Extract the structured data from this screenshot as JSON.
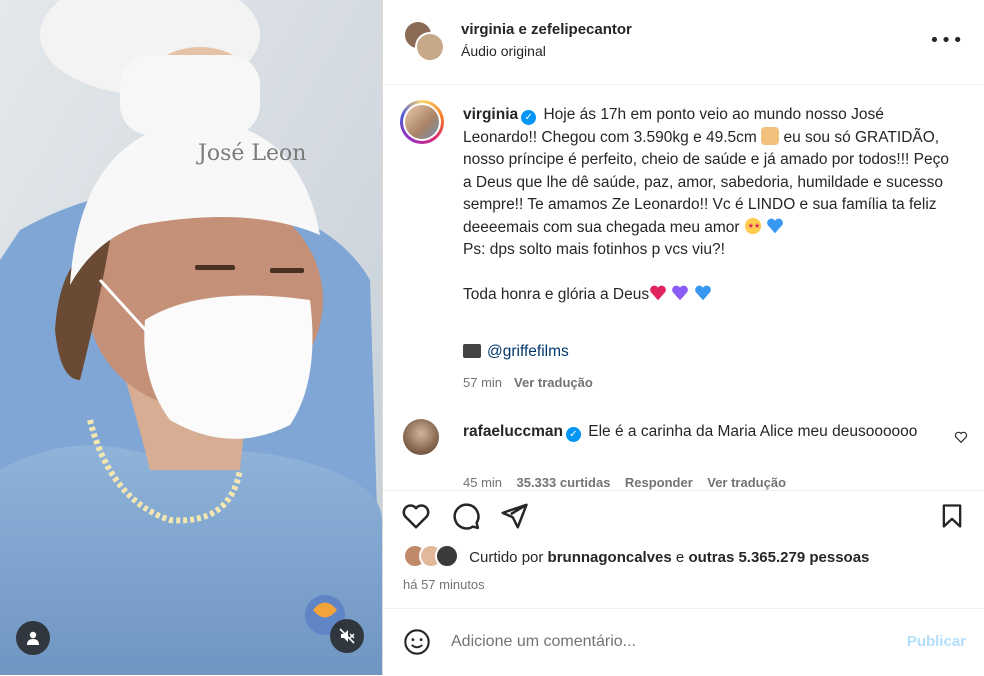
{
  "media": {
    "cap_text": "José Leon",
    "user_tag_icon": "user-icon",
    "mute_icon": "speaker-muted-icon"
  },
  "header": {
    "title": "virginia e zefelipecantor",
    "subtitle": "Áudio original",
    "more_icon": "more-horizontal-icon",
    "more_label": "•••"
  },
  "caption": {
    "username": "virginia",
    "line1": "Hoje ás 17h em ponto veio ao mundo nosso José Leonardo!! Chegou com 3.590kg e 49.5cm",
    "line2": "eu sou só GRATIDÃO, nosso príncipe é perfeito, cheio de saúde e já amado por todos!!! Peço a Deus que lhe dê saúde, paz, amor, sabedoria, humildade e sucesso sempre!! Te amamos Ze Leonardo!! Vc é LINDO e sua família ta feliz deeeemais com sua chegada meu amor",
    "ps": "Ps: dps solto mais fotinhos p vcs viu?!",
    "honra": "Toda honra e glória a Deus",
    "credit": "@griffefilms",
    "time": "57 min",
    "translate": "Ver tradução",
    "colors": {
      "heart_blue": "#3897f0",
      "heart_purple": "#8a5cf6",
      "heart_red": "#e0245e"
    }
  },
  "comment": {
    "username": "rafaeluccman",
    "text": "Ele é a carinha da Maria Alice meu deusoooooo",
    "meta_time": "45 min",
    "meta_likes": "35.333 curtidas",
    "meta_reply": "Responder",
    "meta_translate": "Ver tradução"
  },
  "actions": {
    "like_icon": "heart-icon",
    "comment_icon": "comment-icon",
    "share_icon": "send-icon",
    "save_icon": "bookmark-icon"
  },
  "likes": {
    "prefix": "Curtido por",
    "user": "brunnagoncalves",
    "middle": "e",
    "others": "outras 5.365.279 pessoas"
  },
  "timestamp": "há 57 minutos",
  "comment_box": {
    "placeholder": "Adicione um comentário...",
    "post_label": "Publicar",
    "emoji_icon": "smiley-icon"
  },
  "colors": {
    "accent": "#0095f6",
    "post_disabled": "#b2dffc",
    "muted_text": "#737373",
    "link": "#00376b"
  }
}
